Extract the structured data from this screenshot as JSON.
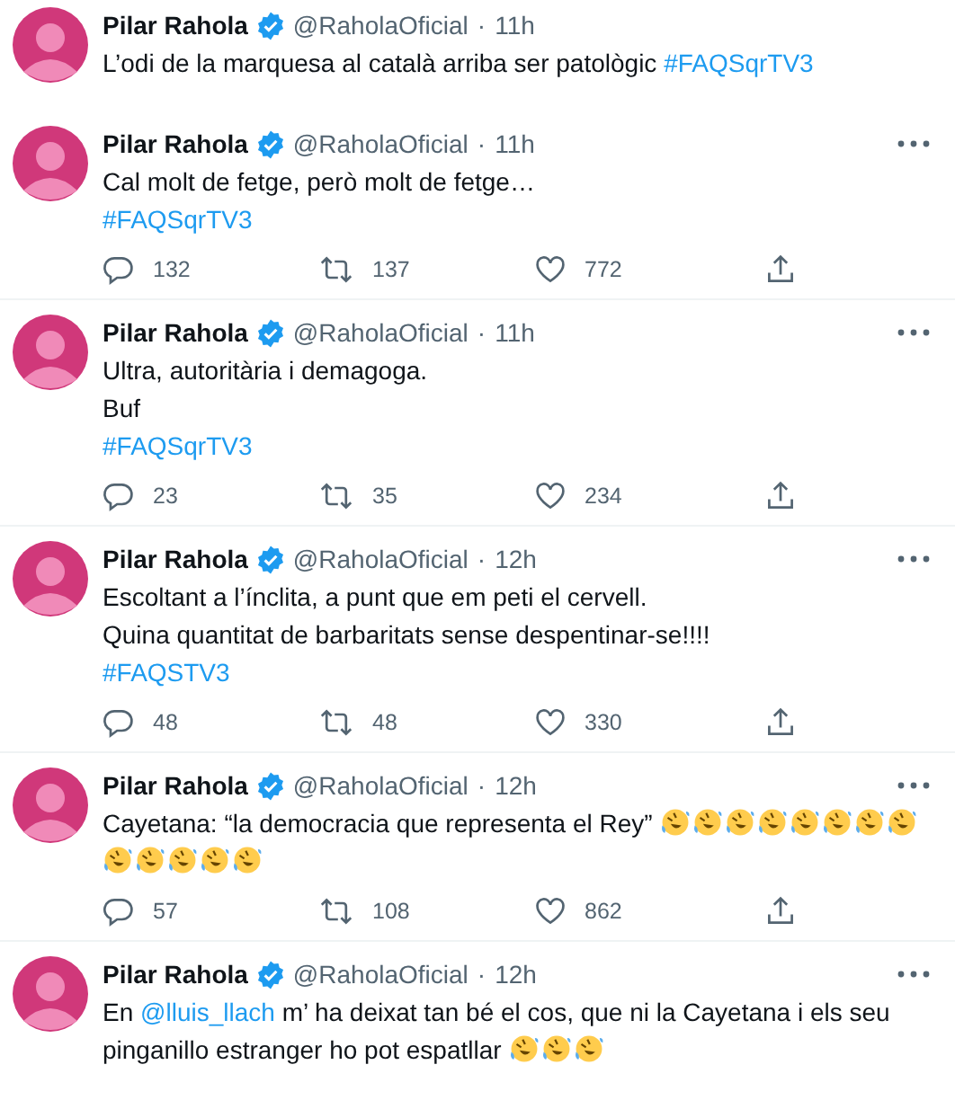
{
  "tweets": [
    {
      "name": "Pilar Rahola",
      "verified": true,
      "handle": "@RaholaOficial",
      "separator": "·",
      "time": "11h",
      "show_menu": false,
      "lines": [
        [
          {
            "kind": "text",
            "text": "L’odi de la marquesa al català arriba ser patològic "
          },
          {
            "kind": "link",
            "text": "#FAQSqrTV3"
          }
        ]
      ]
    },
    {
      "name": "Pilar Rahola",
      "verified": true,
      "handle": "@RaholaOficial",
      "separator": "·",
      "time": "11h",
      "show_menu": true,
      "lines": [
        [
          {
            "kind": "text",
            "text": "Cal molt de fetge, però molt de fetge…"
          }
        ],
        [
          {
            "kind": "link",
            "text": "#FAQSqrTV3"
          }
        ]
      ],
      "actions": {
        "replies": "132",
        "retweets": "137",
        "likes": "772"
      }
    },
    {
      "name": "Pilar Rahola",
      "verified": true,
      "handle": "@RaholaOficial",
      "separator": "·",
      "time": "11h",
      "show_menu": true,
      "lines": [
        [
          {
            "kind": "text",
            "text": "Ultra, autoritària i demagoga."
          }
        ],
        [
          {
            "kind": "text",
            "text": "Buf"
          }
        ],
        [
          {
            "kind": "link",
            "text": "#FAQSqrTV3"
          }
        ]
      ],
      "actions": {
        "replies": "23",
        "retweets": "35",
        "likes": "234"
      }
    },
    {
      "name": "Pilar Rahola",
      "verified": true,
      "handle": "@RaholaOficial",
      "separator": "·",
      "time": "12h",
      "show_menu": true,
      "lines": [
        [
          {
            "kind": "text",
            "text": "Escoltant a l’ínclita, a punt que em peti el cervell."
          }
        ],
        [
          {
            "kind": "text",
            "text": "Quina quantitat de barbaritats sense despentinar-se!!!!"
          }
        ],
        [
          {
            "kind": "link",
            "text": "#FAQSTV3"
          }
        ]
      ],
      "actions": {
        "replies": "48",
        "retweets": "48",
        "likes": "330"
      }
    },
    {
      "name": "Pilar Rahola",
      "verified": true,
      "handle": "@RaholaOficial",
      "separator": "·",
      "time": "12h",
      "show_menu": true,
      "lines": [
        [
          {
            "kind": "text",
            "text": "Cayetana: “la democracia que representa el Rey” "
          },
          {
            "kind": "emoji"
          },
          {
            "kind": "emoji"
          },
          {
            "kind": "emoji"
          },
          {
            "kind": "emoji"
          },
          {
            "kind": "emoji"
          },
          {
            "kind": "emoji"
          },
          {
            "kind": "emoji"
          },
          {
            "kind": "emoji"
          }
        ],
        [
          {
            "kind": "emoji"
          },
          {
            "kind": "emoji"
          },
          {
            "kind": "emoji"
          },
          {
            "kind": "emoji"
          },
          {
            "kind": "emoji"
          }
        ]
      ],
      "actions": {
        "replies": "57",
        "retweets": "108",
        "likes": "862"
      }
    },
    {
      "name": "Pilar Rahola",
      "verified": true,
      "handle": "@RaholaOficial",
      "separator": "·",
      "time": "12h",
      "show_menu": true,
      "lines": [
        [
          {
            "kind": "text",
            "text": "En "
          },
          {
            "kind": "link",
            "text": "@lluis_llach"
          },
          {
            "kind": "text",
            "text": " m’ ha deixat tan bé el cos, que ni la Cayetana i els seu"
          }
        ],
        [
          {
            "kind": "text",
            "text": "pinganillo estranger ho pot espatllar "
          },
          {
            "kind": "emoji"
          },
          {
            "kind": "emoji"
          },
          {
            "kind": "emoji"
          }
        ]
      ]
    }
  ]
}
